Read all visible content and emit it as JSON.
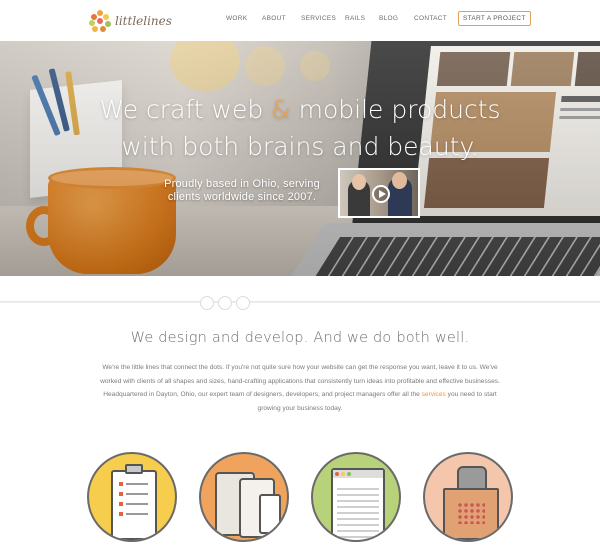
{
  "brand": {
    "name": "littlelines"
  },
  "nav": {
    "items": [
      {
        "label": "WORK"
      },
      {
        "label": "ABOUT"
      },
      {
        "label": "SERVICES"
      },
      {
        "label": "RAILS"
      },
      {
        "label": "BLOG"
      },
      {
        "label": "CONTACT"
      }
    ],
    "cta": "START A PROJECT"
  },
  "hero": {
    "title_line1_a": "We craft web ",
    "title_amp": "&",
    "title_line1_b": " mobile products",
    "title_line2": "with both brains and beauty.",
    "subtitle": "Proudly based in Ohio, serving clients worldwide since 2007."
  },
  "content": {
    "headline": "We design and develop. And we do both well.",
    "intro_before_link": "We're the little lines that connect the dots. If you're not quite sure how your website can get the response you want, leave it to us. We've worked with clients of all shapes and sizes, hand-crafting applications that consistently turn ideas into profitable and effective businesses. Headquartered in Dayton, Ohio, our expert team of designers, developers, and project managers offer all the ",
    "intro_link": "services",
    "intro_after_link": " you need to start growing your business today."
  },
  "service_icons": [
    "clipboard-icon",
    "devices-icon",
    "browser-grid-icon",
    "shopping-bag-icon"
  ],
  "colors": {
    "accent": "#f19d3a",
    "circle_yellow": "#f6cd4c",
    "circle_orange": "#f0a35d",
    "circle_green": "#b8d27a",
    "circle_peach": "#f4c7ac"
  }
}
